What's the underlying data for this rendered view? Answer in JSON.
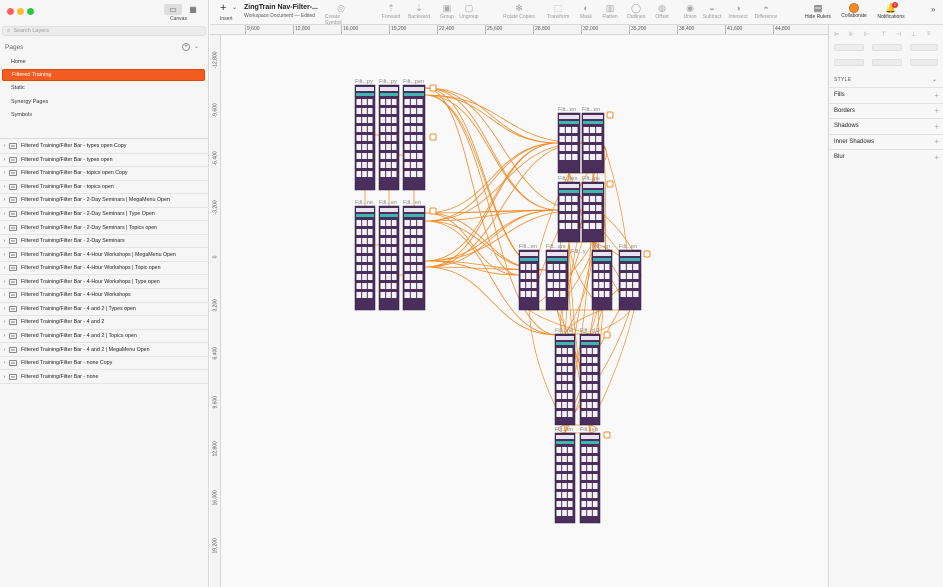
{
  "sidebar": {
    "canvas_label": "Canvas",
    "search_placeholder": "Search Layers",
    "pages_heading": "Pages",
    "pages": [
      "Home",
      "Filtered Training",
      "Static",
      "Synergy Pages",
      "Symbols"
    ],
    "active_page": 1,
    "layers": [
      "Filtered Training/Filter Bar - types open Copy",
      "Filtered Training/Filter Bar - types open",
      "Filtered Training/Filter Bar - topics open Copy",
      "Filtered Training/Filter Bar - topics open",
      "Filtered Training/Filter Bar - 2-Day Seminars | MegaMenu Open",
      "Filtered Training/Filter Bar - 2-Day Seminars | Type Open",
      "Filtered Training/Filter Bar - 2-Day Seminars | Topics open",
      "Filtered Training/Filter Bar - 2-Day Seminars",
      "Filtered Training/Filter Bar - 4-Hour Workshops | MegaMenu Open",
      "Filtered Training/Filter Bar - 4-Hour Workshops | Topic open",
      "Filtered Training/Filter Bar - 4-Hour Workshops | Type open",
      "Filtered Training/Filter Bar - 4-Hour Workshops",
      "Filtered Training/Filter Bar - 4 and 2 | Types open",
      "Filtered Training/Filter Bar - 4 and 2",
      "Filtered Training/Filter Bar - 4 and 2 | Topics open",
      "Filtered Training/Filter Bar - 4 and 2 | MegaMenu Open",
      "Filtered Training/Filter Bar - none Copy",
      "Filtered Training/Filter Bar - none"
    ]
  },
  "toolbar": {
    "insert": "Insert",
    "title": "ZingTrain Nav-Filter-...",
    "subtitle": "Workspace Document — Edited",
    "tools": [
      {
        "label": "Create Symbol",
        "icon": "symbol-icon"
      },
      {
        "label": "Forward",
        "icon": "forward-icon"
      },
      {
        "label": "Backward",
        "icon": "backward-icon"
      },
      {
        "label": "Group",
        "icon": "group-icon"
      },
      {
        "label": "Ungroup",
        "icon": "ungroup-icon"
      },
      {
        "label": "Rotate Copies",
        "icon": "rotate-copies-icon"
      },
      {
        "label": "Transform",
        "icon": "transform-icon"
      },
      {
        "label": "Mask",
        "icon": "mask-icon"
      },
      {
        "label": "Flatten",
        "icon": "flatten-icon"
      },
      {
        "label": "Outlines",
        "icon": "outlines-icon"
      },
      {
        "label": "Offset",
        "icon": "offset-icon"
      },
      {
        "label": "Union",
        "icon": "union-icon"
      },
      {
        "label": "Subtract",
        "icon": "subtract-icon"
      },
      {
        "label": "Intersect",
        "icon": "intersect-icon"
      },
      {
        "label": "Difference",
        "icon": "difference-icon"
      },
      {
        "label": "Hide Rulers",
        "icon": "rulers-icon"
      },
      {
        "label": "Collaborate",
        "icon": "collaborate-icon"
      },
      {
        "label": "Notifications",
        "icon": "bell-icon"
      }
    ],
    "notification_count": "1"
  },
  "rulers": {
    "horizontal": [
      "9,600",
      "12,800",
      "16,000",
      "19,200",
      "22,400",
      "25,600",
      "28,800",
      "32,000",
      "35,200",
      "38,400",
      "41,600",
      "44,800"
    ],
    "vertical": [
      "-12,800",
      "-9,600",
      "-6,400",
      "-3,200",
      "0",
      "3,200",
      "6,400",
      "9,600",
      "12,800",
      "16,000",
      "19,200"
    ]
  },
  "canvas": {
    "artboard_labels": [
      "Filt...py",
      "Filt...py",
      "Filt...pen",
      "Filt...ne",
      "Filt...en",
      "Filt...en",
      "Filt...en",
      "Filt...en",
      "Filt...ars",
      "Filt...ps",
      "Filt...en",
      "Filt...ars",
      "Filt...en",
      "Filt...en",
      "Filt...ne",
      "Filt...y",
      "Filt...d 2",
      "Filt...en",
      "Filt...en"
    ],
    "link_color": "#f28c28",
    "artboard_color": "#4a2e5c"
  },
  "inspector": {
    "style_heading": "STYLE",
    "sections": [
      "Fills",
      "Borders",
      "Shadows",
      "Inner Shadows",
      "Blur"
    ]
  }
}
